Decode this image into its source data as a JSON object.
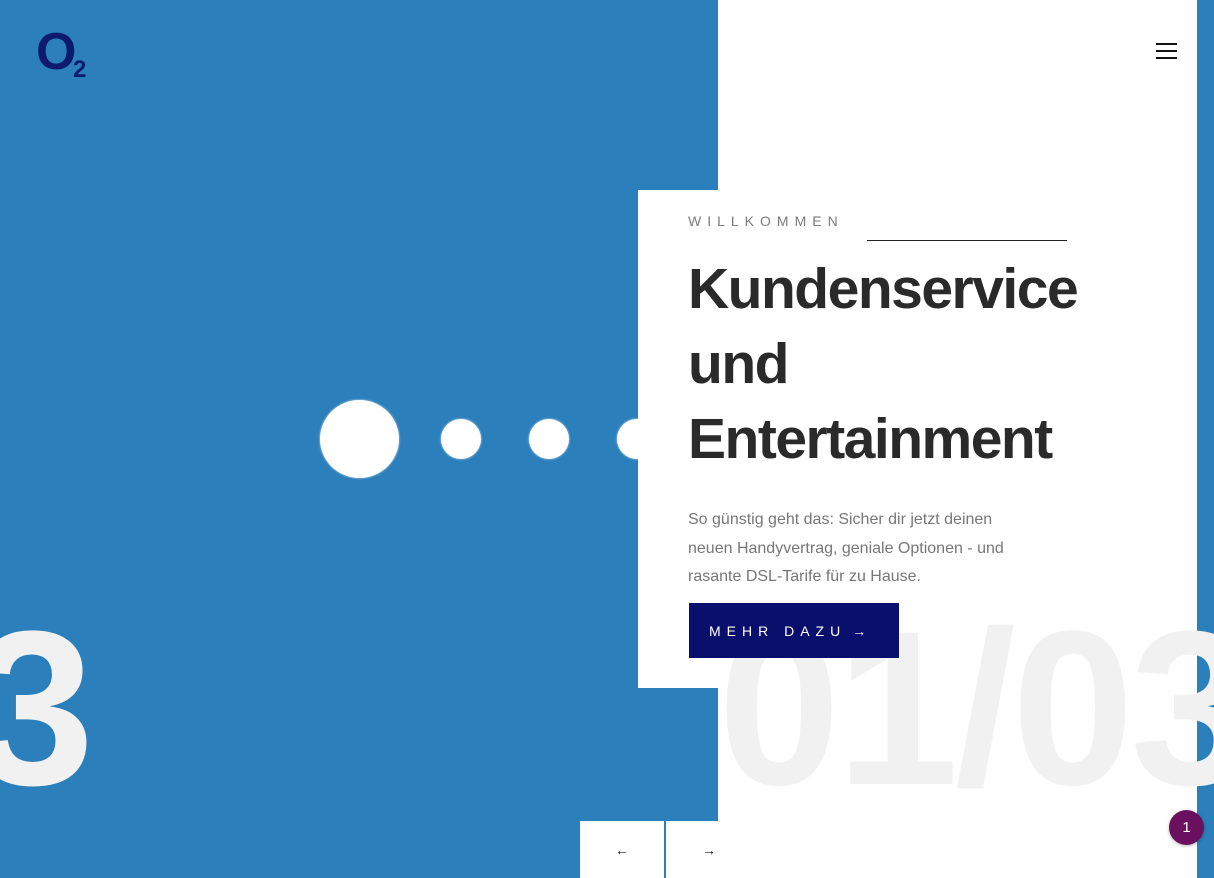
{
  "brand": {
    "logo_main": "O",
    "logo_sub": "2"
  },
  "hero": {
    "eyebrow": "WILLKOMMEN",
    "headline": "Kundenservice und Entertainment",
    "description": "So günstig geht das: Sicher dir jetzt deinen neuen Handyvertrag, geniale Optionen - und rasante DSL-Tarife für zu Hause.",
    "cta_label": "MEHR DAZU",
    "cta_arrow": "→"
  },
  "slider": {
    "counter_left": "3",
    "counter_right": "01/03",
    "prev_arrow": "←",
    "next_arrow": "→"
  },
  "notification_badge": "1",
  "colors": {
    "panel_blue": "#2b7fbb",
    "cta_navy": "#0a0f6e",
    "badge_purple": "#6b0f5f"
  }
}
